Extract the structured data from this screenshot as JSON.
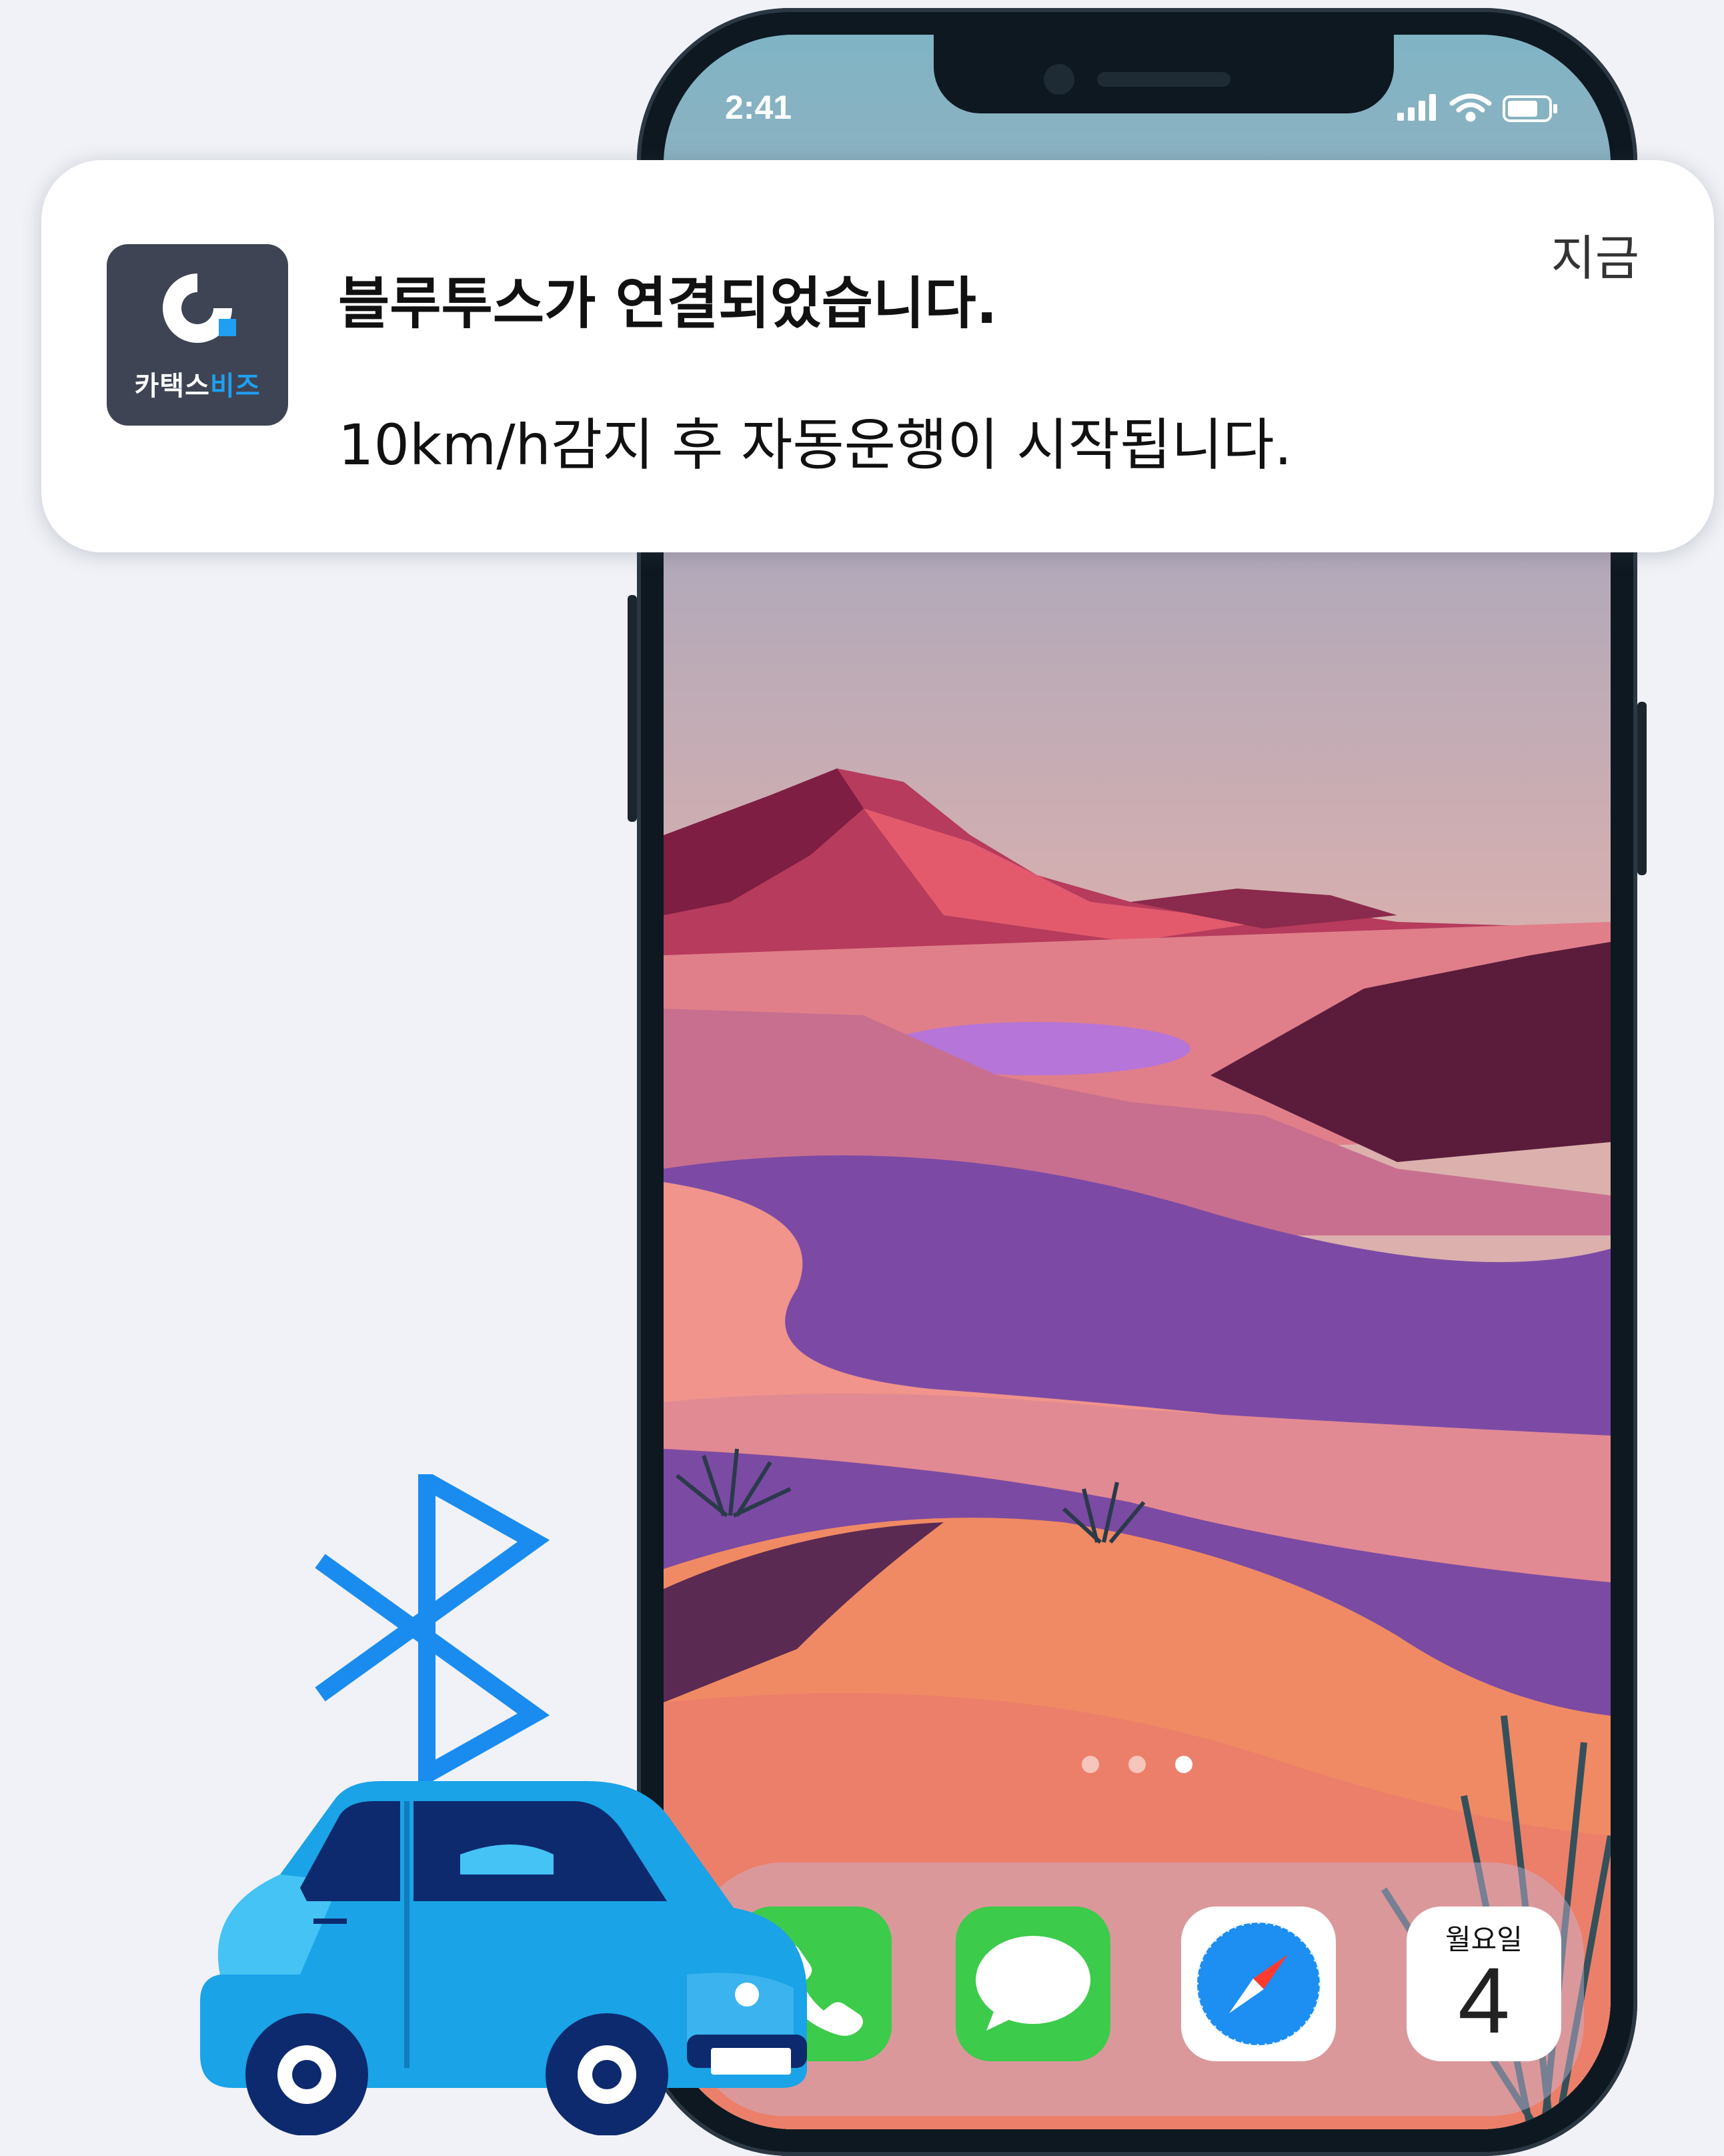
{
  "status_bar": {
    "time": "2:41"
  },
  "notification": {
    "app_name_prefix": "카택스",
    "app_name_accent": "비즈",
    "title": "블루투스가 연결되었습니다.",
    "body": "10km/h감지 후 자동운행이 시작됩니다.",
    "time": "지금"
  },
  "home_screen": {
    "page_count": 3,
    "active_page": 3,
    "dock": [
      {
        "name": "phone",
        "icon": "phone-icon"
      },
      {
        "name": "messages",
        "icon": "messages-icon"
      },
      {
        "name": "safari",
        "icon": "compass-icon"
      },
      {
        "name": "calendar",
        "icon": "calendar-icon",
        "day": "월요일",
        "date": "4"
      }
    ]
  },
  "illustration": {
    "bluetooth_icon": "bluetooth-icon",
    "car_icon": "car-icon"
  },
  "colors": {
    "bluetooth": "#1a8cf0",
    "car_body": "#1aa3e6",
    "notification_bg": "#ffffff",
    "app_accent": "#1e9ff2"
  }
}
